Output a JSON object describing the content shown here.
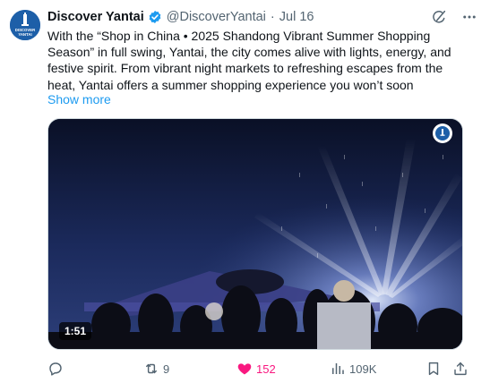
{
  "tweet": {
    "author_name": "Discover Yantai",
    "handle": "@DiscoverYantai",
    "separator": "·",
    "date": "Jul 16",
    "avatar_text": [
      "DISCOVER",
      "YANTAI"
    ],
    "text_lines": [
      "With the “Shop in China • 2025 Shandong Vibrant Summer Shopping",
      "Season” in full swing, Yantai, the city comes alive with lights, energy, and",
      "festive spirit. From vibrant night markets to refreshing escapes from the",
      "heat, Yantai offers a summer shopping experience you won’t soon"
    ],
    "show_more": "Show more"
  },
  "media": {
    "type": "video",
    "duration": "1:51"
  },
  "actions": {
    "reply_count": "",
    "retweet_count": "9",
    "like_count": "152",
    "views_count": "109K"
  },
  "colors": {
    "accent": "#1d9bf0",
    "like": "#f91880",
    "muted": "#536471",
    "text": "#0f1419",
    "avatar_bg": "#1d5fa8"
  },
  "icons": {
    "verified": "verified-badge-icon",
    "grok": "grok-icon",
    "more": "more-icon",
    "reply": "reply-icon",
    "retweet": "retweet-icon",
    "like": "heart-icon",
    "views": "views-icon",
    "bookmark": "bookmark-icon",
    "share": "share-icon"
  }
}
